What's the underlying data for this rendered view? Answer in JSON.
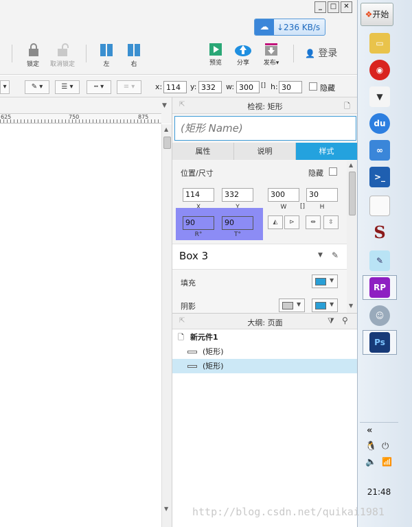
{
  "window": {
    "min_label": "_",
    "max_label": "□",
    "close_label": "✕"
  },
  "speed": {
    "value": "↓236 KB/s"
  },
  "toolbar": {
    "lock": "锁定",
    "unlock": "取消锁定",
    "left": "左",
    "right": "右",
    "preview": "预览",
    "share": "分享",
    "publish": "发布▾",
    "login": "登录"
  },
  "formatbar": {
    "x_label": "x:",
    "x_value": "114",
    "y_label": "y:",
    "y_value": "332",
    "w_label": "w:",
    "w_value": "300",
    "h_label": "h:",
    "h_value": "30",
    "hide_label": "隐藏"
  },
  "ruler": {
    "ticks": [
      "625",
      "750",
      "875"
    ]
  },
  "inspector": {
    "header": "检视: 矩形",
    "name_placeholder": "(矩形 Name)",
    "tabs": [
      "属性",
      "说明",
      "样式"
    ],
    "position_title": "位置/尺寸",
    "hide_label": "隐藏",
    "x": "114",
    "y": "332",
    "w": "300",
    "h": "30",
    "x_cap": "X",
    "y_cap": "Y",
    "w_cap": "W",
    "h_cap": "H",
    "r": "90",
    "t": "90",
    "r_cap": "R°",
    "t_cap": "T°",
    "style_name": "Box 3",
    "fill_label": "填充",
    "shadow_label": "阴影",
    "fill_color": "#2a9fd6",
    "shadow_color": "#2a9fd6"
  },
  "outline": {
    "header": "大纲: 页面",
    "root": "新元件1",
    "items": [
      "(矩形)",
      "(矩形)"
    ]
  },
  "taskbar": {
    "start": "开始",
    "clock": "21:48",
    "expand": "«",
    "apps": [
      "folder",
      "video",
      "fox",
      "baidu",
      "cloud",
      "powershell",
      "doc",
      "s",
      "notepad",
      "rp",
      "avatar",
      "ps"
    ]
  },
  "watermark": "http://blog.csdn.net/quikai1981"
}
